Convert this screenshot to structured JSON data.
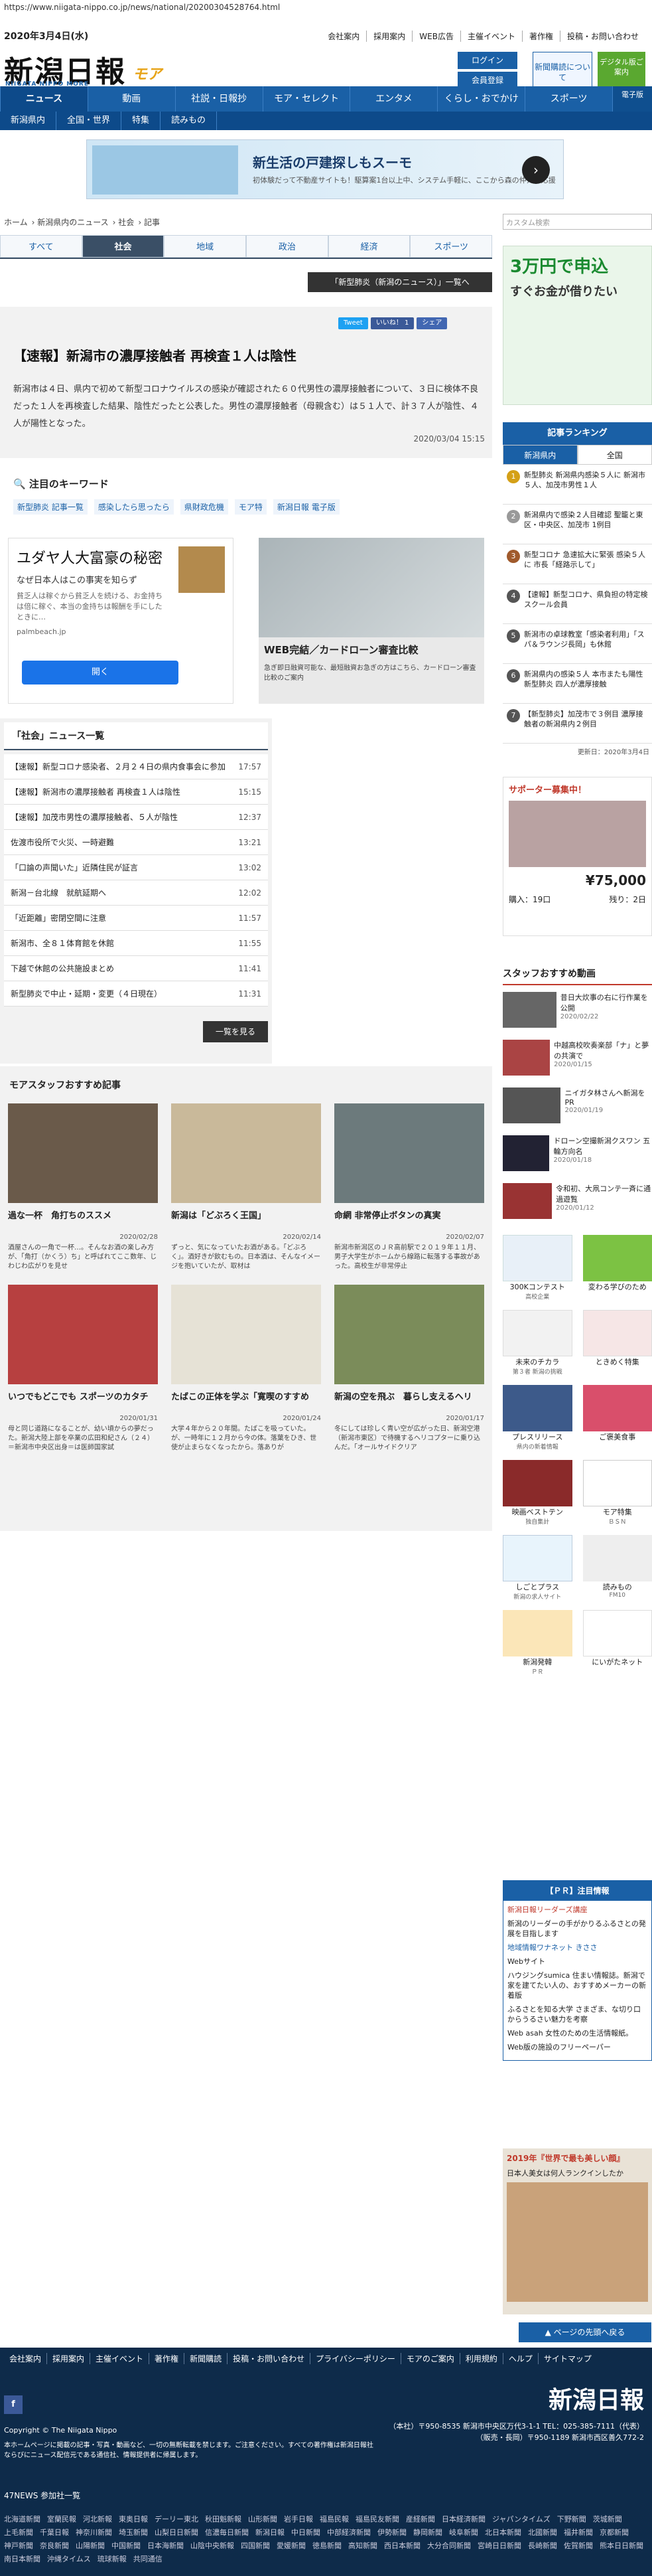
{
  "url": "https://www.niigata-nippo.co.jp/news/national/20200304528764.html",
  "header": {
    "date": "2020年3月4日(水)",
    "logo": "新潟日報",
    "logo_sub": "NIIGATA NIPPO MORE",
    "logo_more": "モア",
    "top_links": [
      "会社案内",
      "採用案内",
      "WEB広告",
      "主催イベント",
      "著作権",
      "投稿・お問い合わせ"
    ],
    "subscribe": "新聞購読について",
    "login": "ログイン",
    "register": "会員登録",
    "digital": "デジタル版ご案内"
  },
  "nav": {
    "items": [
      "ニュース",
      "動画",
      "社説・日報抄",
      "モア・セレクト",
      "エンタメ",
      "くらし・おでかけ",
      "スポーツ"
    ],
    "paper": "電子版"
  },
  "subnav": [
    "新潟県内",
    "全国・世界",
    "特集",
    "読みもの"
  ],
  "top_ad": {
    "title": "新生活の戸建探しもスーモ",
    "desc": "初体験だって不動産サイトも！駆算案1台以上中、システム手軽に、ここから森の仲介で応援"
  },
  "breadcrumb": [
    "ホーム",
    "新潟県内のニュース",
    "社会",
    "記事"
  ],
  "search_placeholder": "カスタム検索",
  "category_tabs": [
    "すべて",
    "社会",
    "地域",
    "政治",
    "経済",
    "スポーツ"
  ],
  "category_list_button": "「新型肺炎（新潟のニュース）」一覧へ",
  "share": [
    "Tweet",
    "いいね！ 1",
    "シェア"
  ],
  "article": {
    "title": "【速報】新潟市の濃厚接触者 再検査１人は陰性",
    "body": "新潟市は４日、県内で初めて新型コロナウイルスの感染が確認された６０代男性の濃厚接触者について、３日に検体不良だった１人を再検査した結果、陰性だったと公表した。男性の濃厚接触者（母親含む）は５１人で、計３７人が陰性、４人が陽性となった。",
    "time": "2020/03/04 15:15"
  },
  "keywords": {
    "title": "注目のキーワード",
    "items": [
      "新型肺炎 記事一覧",
      "感染したら思ったら",
      "県財政危機",
      "モア特",
      "新潟日報 電子版"
    ]
  },
  "ad_mid1": {
    "title": "ユダヤ人大富豪の秘密",
    "sub": "なぜ日本人はこの事実を知らず",
    "desc": "貧乏人は稼ぐから貧乏人を続ける、お金持ちは倍に稼ぐ、本当の金持ちは報酬を手にしたときに…",
    "source": "palmbeach.jp",
    "button": "開く"
  },
  "ad_mid2": {
    "title": "WEB完結／カードローン審査比較",
    "desc": "急ぎ即日融資可能な、最短融資お急ぎの方はこちら、カードローン審査比較のご案内"
  },
  "news_list": {
    "title": "「社会」ニュース一覧",
    "items": [
      {
        "t": "【速報】新型コロナ感染者、２月２４日の県内食事会に参加",
        "time": "17:57"
      },
      {
        "t": "【速報】新潟市の濃厚接触者 再検査１人は陰性",
        "time": "15:15"
      },
      {
        "t": "【速報】加茂市男性の濃厚接触者、５人が陰性",
        "time": "12:37"
      },
      {
        "t": "佐渡市役所で火災、一時避難",
        "time": "13:21"
      },
      {
        "t": "「口論の声聞いた」近隣住民が証言",
        "time": "13:02"
      },
      {
        "t": "新潟－台北線　就航延期へ",
        "time": "12:02"
      },
      {
        "t": "「近距離」密閉空間に注意",
        "time": "11:57"
      },
      {
        "t": "新潟市、全８１体育館を休館",
        "time": "11:55"
      },
      {
        "t": "下越で休館の公共施設まとめ",
        "time": "11:41"
      },
      {
        "t": "新型肺炎で中止・延期・変更（４日現在）",
        "time": "11:31"
      }
    ],
    "more": "一覧を見る"
  },
  "recommend": {
    "title": "モアスタッフおすすめ記事",
    "items": [
      {
        "t": "過な一杯　角打ちのススメ",
        "dt": "2020/02/28",
        "d": "酒屋さんの一角で一杯…。そんなお酒の楽しみ方が、「角打（かくう）ち」と呼ばれてここ数年、じわじわ広がりを見せ"
      },
      {
        "t": "新潟は「どぶろく王国」",
        "dt": "2020/02/14",
        "d": "ずっと、気になっていたお酒がある。「どぶろく」。酒好きが飲むもの。日本酒は、そんなイメージを抱いていたが、取材は"
      },
      {
        "t": "命網 非常停止ボタンの真実",
        "dt": "2020/02/07",
        "d": "新潟市新潟区のＪＲ高前駅で２０１９年１１月、男子大学生がホームから線路に転落する事故があった。高校生が非常停止"
      },
      {
        "t": "いつでもどこでも スポーツのカタチ",
        "dt": "2020/01/31",
        "d": "母と同じ道路になることが、幼い頃からの夢だった。新潟大陸上部を卒業の広田和紀さん（２４）＝新潟市中央区出身＝は医師国家試"
      },
      {
        "t": "たばこの正体を学ぶ「寛喫のすすめ",
        "dt": "2020/01/24",
        "d": "大学４年から２０年間。たばこを吸っていた。が、一時年に１２月から今の体。落葉をひき、世使が止まらなくなったから。落ありが"
      },
      {
        "t": "新潟の空を飛ぶ　暮らし支えるヘリ",
        "dt": "2020/01/17",
        "d": "冬にしては珍しく青い空が広がった日、新潟空港（新潟市東区）で待機するヘリコプターに乗り込んだ。「オールサイドクリア"
      }
    ]
  },
  "side_ad": {
    "title": "3万円で申込",
    "sub": "すぐお金が借りたい"
  },
  "ranking": {
    "title": "記事ランキング",
    "tabs": [
      "新潟県内",
      "全国"
    ],
    "items": [
      "新型肺炎 新潟県内感染５人に 新潟市５人、加茂市男性１人",
      "新潟県内で感染２人目確認 聖籠と東区・中央区、加茂市 1例目",
      "新型コロナ 急速拡大に緊張 感染５人に 市長「経路示して」",
      "【速報】新型コロナ、県負担の特定検スクール会員",
      "新潟市の卓球教室「感染者利用」「スパ＆ラウンジ長岡」も休館",
      "新潟県内の感染５人 本市またも陽性 新型肺炎 四人が濃厚接触",
      "【新型肺炎】加茂市で３例目 濃厚接触者の新潟県内２例目"
    ],
    "updated": "更新日：2020年3月4日"
  },
  "ranking_ad": {
    "title": "サポーター募集中！",
    "price": "¥75,000",
    "buy": "購入：19口",
    "rest": "残り：2日"
  },
  "staff_video": {
    "title": "スタッフおすすめ動画",
    "items": [
      {
        "t": "昔日大炊事の右に行作業を公開",
        "dt": "2020/02/22"
      },
      {
        "t": "中越高校吹奏楽部「ナ」と夢の共演で",
        "dt": "2020/01/15"
      },
      {
        "t": "ニイガタ林さんへ新潟をPR",
        "dt": "2020/01/19"
      },
      {
        "t": "ドローン空撮新潟クスワン 五輪方向名",
        "dt": "2020/01/18"
      },
      {
        "t": "令和初、大凧コンテ一斉に通過遊覧",
        "dt": "2020/01/12"
      }
    ]
  },
  "banners": [
    {
      "t": "300Kコンテスト",
      "s": "高校企業"
    },
    {
      "t": "変わる学びのため",
      "s": ""
    },
    {
      "t": "未来のチカラ",
      "s": "第３者 新潟の挑戦"
    },
    {
      "t": "ときめく特集",
      "s": ""
    },
    {
      "t": "プレスリリース",
      "s": "県内の新着情報"
    },
    {
      "t": "ご褒美食事",
      "s": ""
    },
    {
      "t": "映画ベストテン",
      "s": "独自集計"
    },
    {
      "t": "モア特集",
      "s": "ＢＳＮ"
    },
    {
      "t": "しごとプラス",
      "s": "新潟の求人サイト"
    },
    {
      "t": "読みもの",
      "s": "FM10"
    },
    {
      "t": "新潟発韓",
      "s": "ＰＲ"
    },
    {
      "t": "にいがたネット",
      "s": ""
    }
  ],
  "pr": {
    "title": "【ＰＲ】注目情報",
    "items": [
      "新潟日報リーダーズ講座",
      "新潟のリーダーの手がかりるふるさとの発展を目指します",
      "地域情報ワナネット きささ",
      "Webサイト",
      "ハウジングsumica 住まい情報誌。新潟で家を建てたい人の、おすすめメーカーの新着版",
      "ふるさとを知る大学 さまざま、な切り口からうるさい魅力を考察",
      "Web asah 女性のための生活情報紙。",
      "Web版の施設のフリーペーパー"
    ]
  },
  "bottom_ad": {
    "title": "2019年『世界で最も美しい顔』",
    "sub": "日本人美女は何人ランクインしたか"
  },
  "pagetop": "ページの先頭へ戻る",
  "footer": {
    "links": [
      "会社案内",
      "採用案内",
      "主催イベント",
      "著作権",
      "新聞購読",
      "投稿・お問い合わせ",
      "プライバシーポリシー",
      "モアのご案内",
      "利用規約",
      "ヘルプ",
      "サイトマップ"
    ],
    "logo": "新潟日報",
    "copyright": "Copyright © The Niigata Nippo",
    "notice": "本ホームページに掲載の記事・写真・動画など、一切の無断転載を禁じます。ご注意ください。すべての著作権は新潟日報社ならびにニュース配信元である通信社、情報提供者に帰属します。",
    "address": "（本社）〒950-8535 新潟市中央区万代3-1-1 TEL：025-385-7111（代表）（販売・長岡）〒950-1189 新潟市西区善久772-2",
    "list_title": "47NEWS 参加社一覧",
    "sites": [
      "北海道新聞",
      "室蘭民報",
      "河北新報",
      "東奥日報",
      "デーリー東北",
      "秋田魁新報",
      "山形新聞",
      "岩手日報",
      "福島民報",
      "福島民友新聞",
      "産経新聞",
      "日本経済新聞",
      "ジャパンタイムズ",
      "下野新聞",
      "茨城新聞",
      "上毛新聞",
      "千葉日報",
      "神奈川新聞",
      "埼玉新聞",
      "山梨日日新聞",
      "信濃毎日新聞",
      "新潟日報",
      "中日新聞",
      "中部経済新聞",
      "伊勢新聞",
      "静岡新聞",
      "岐阜新聞",
      "北日本新聞",
      "北國新聞",
      "福井新聞",
      "京都新聞",
      "神戸新聞",
      "奈良新聞",
      "山陽新聞",
      "中国新聞",
      "日本海新聞",
      "山陰中央新報",
      "四国新聞",
      "愛媛新聞",
      "徳島新聞",
      "高知新聞",
      "西日本新聞",
      "大分合同新聞",
      "宮崎日日新聞",
      "長崎新聞",
      "佐賀新聞",
      "熊本日日新聞",
      "南日本新聞",
      "沖縄タイムス",
      "琉球新報",
      "共同通信"
    ]
  }
}
